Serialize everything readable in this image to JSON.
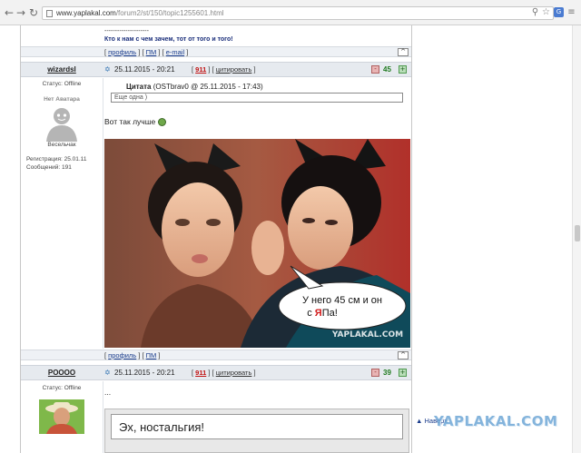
{
  "browser": {
    "url_domain": "www.yaplakal.com",
    "url_path": "/forum2/st/150/topic1255601.html",
    "back_icon": "back-arrow-icon",
    "forward_icon": "forward-arrow-icon",
    "reload_icon": "reload-icon",
    "page_icon": "page-icon",
    "search_icon": "magnifier-icon",
    "bookmark_icon": "star-icon",
    "menu_icon": "menu-icon"
  },
  "previous_post": {
    "signature_separator": "---------------------",
    "signature": "Кто к нам с чем зачем, тот от того и того!",
    "footer": {
      "profile": "профиль",
      "pm": "ПМ",
      "email": "e-mail",
      "top_label": "^"
    }
  },
  "post1": {
    "author": "wizardsl",
    "date": "25.11.2015 - 20:21",
    "post_number": "911",
    "quote_link": "цитировать",
    "rating": "45",
    "rate_minus_label": "-",
    "rate_plus_label": "+",
    "status_label": "Статус:",
    "status_value": "Offline",
    "avatar_caption": "Нет Аватара",
    "rank": "Весельчак",
    "registration": "Регистрация: 25.01.11",
    "posts": "Сообщений: 191",
    "quote_header_prefix": "Цитата",
    "quote_header_meta": "(OSTbrav0 @ 25.11.2015 - 17:43)",
    "quote_text": "Еще одна )",
    "text": "Вот так лучше",
    "image": {
      "bubble_text_line1": "У него 45 см и он",
      "bubble_text_line2_prefix": "с ",
      "bubble_text_highlight": "Я",
      "bubble_text_line2_suffix": "Па!",
      "watermark": "YAPLAKAL.COM"
    },
    "footer": {
      "profile": "профиль",
      "pm": "ПМ",
      "top_label": "^"
    }
  },
  "post2": {
    "author": "POOOO",
    "date": "25.11.2015 - 20:21",
    "post_number": "911",
    "quote_link": "цитировать",
    "rating": "39",
    "rate_minus_label": "-",
    "rate_plus_label": "+",
    "status_label": "Статус:",
    "status_value": "Offline",
    "text": "...",
    "card_title": "Эх, ностальгия!"
  },
  "page": {
    "back_to_top": "▲ Наверх",
    "site_watermark": "YAPLAKAL.COM"
  },
  "colors": {
    "header_bg": "#e6eaef",
    "rating_green": "#1e7a1e",
    "post_number_red": "#c01010",
    "link_blue": "#1a3c8c"
  }
}
